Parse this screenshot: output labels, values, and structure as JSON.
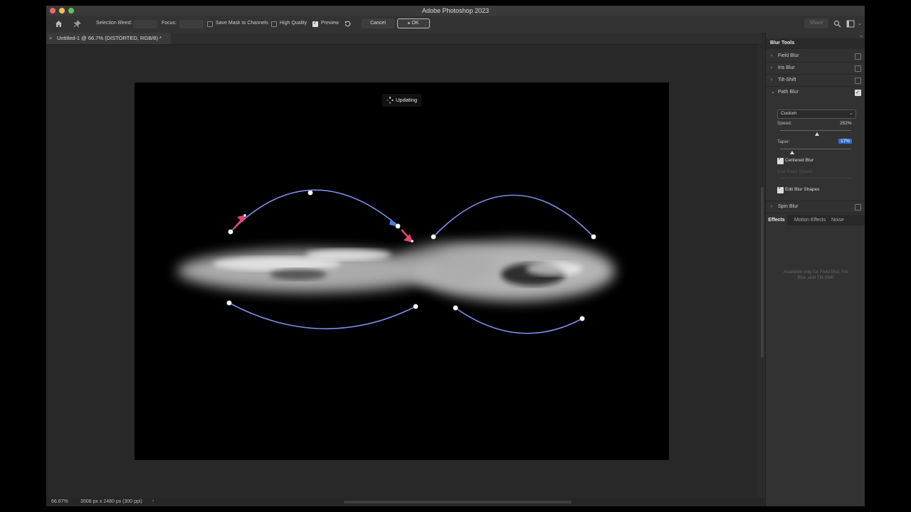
{
  "app": {
    "title": "Adobe Photoshop 2023"
  },
  "options": {
    "selection_bleed_label": "Selection Bleed:",
    "focus_label": "Focus:",
    "save_mask_label": "Save Mask to Channels",
    "save_mask_checked": false,
    "high_quality_label": "High Quality",
    "high_quality_checked": false,
    "preview_label": "Preview",
    "preview_checked": true,
    "cancel_label": "Cancel",
    "ok_label": "OK",
    "share_label": "Share"
  },
  "document": {
    "tab_title": "Untitled-1 @ 66.7% (DISTORTED, RGB/8) *",
    "updating_label": "Updating"
  },
  "status": {
    "zoom": "66.67%",
    "doc_info": "3508 px x 2480 px (300 ppi)"
  },
  "panel": {
    "title": "Blur Tools",
    "tools": [
      {
        "label": "Field Blur",
        "checked": false
      },
      {
        "label": "Iris Blur",
        "checked": false
      },
      {
        "label": "Tilt-Shift",
        "checked": false
      },
      {
        "label": "Path Blur",
        "checked": true
      }
    ],
    "path_blur": {
      "mode": "Custom",
      "speed_label": "Speed:",
      "speed_value": "252%",
      "speed_fraction": 0.52,
      "taper_label": "Taper:",
      "taper_value": "17%",
      "taper_fraction": 0.17,
      "centered_label": "Centered Blur",
      "centered_checked": true,
      "end_point_speed_label": "End Point Speed:",
      "edit_shapes_label": "Edit Blur Shapes",
      "edit_shapes_checked": true
    },
    "spin_blur": {
      "label": "Spin Blur",
      "checked": false
    },
    "effects_tabs": [
      "Effects",
      "Motion Effects",
      "Noise"
    ],
    "effects_note": "Available only for Field Blur, Iris Blur, and Tilt-Shift"
  },
  "colors": {
    "path": "#7b8fe8",
    "arrow": "#e3456c",
    "accent": "#2f6fce"
  }
}
